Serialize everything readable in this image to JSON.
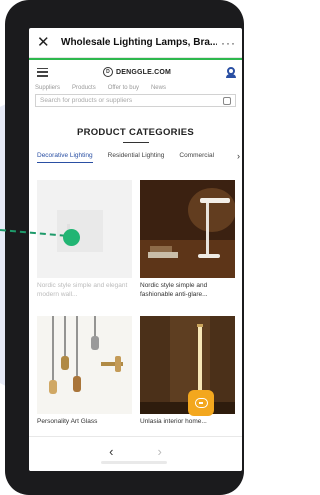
{
  "browser": {
    "title": "Wholesale Lighting Lamps, Bra...",
    "close_glyph": "✕",
    "more_glyph": "···"
  },
  "site": {
    "logo_text": "DENGGLE.COM",
    "logo_mark": "D"
  },
  "top_tabs": [
    "Suppliers",
    "Products",
    "Offer to buy",
    "News"
  ],
  "search": {
    "placeholder": "Search for products or suppliers"
  },
  "categories": {
    "title": "PRODUCT CATEGORIES",
    "tabs": [
      "Decorative Lighting",
      "Residential Lighting",
      "Commercial"
    ],
    "active_index": 0,
    "more_arrow": "›"
  },
  "products": [
    {
      "title": "Nordic style simple and elegant modern wall...",
      "faded": true,
      "image": "light-wall-lamp"
    },
    {
      "title": "Nordic style simple and fashionable anti-glare...",
      "faded": false,
      "image": "desk-lamp"
    },
    {
      "title": "Personality Art Glass",
      "faded": false,
      "image": "pendant-lamps"
    },
    {
      "title": "Unlasia interior home...",
      "faded": false,
      "image": "linear-wall-lamp"
    }
  ],
  "nav": {
    "back": "‹",
    "forward": "›"
  },
  "colors": {
    "accent_blue": "#2a4fa3",
    "load_bar_green": "#2db84d",
    "chat_orange": "#f3a71e",
    "pointer_green": "#21b573"
  },
  "icons": [
    "close-icon",
    "more-icon",
    "menu-icon",
    "logo-icon",
    "user-icon",
    "search-icon",
    "chevron-right-icon",
    "chat-icon",
    "back-icon",
    "forward-icon"
  ]
}
